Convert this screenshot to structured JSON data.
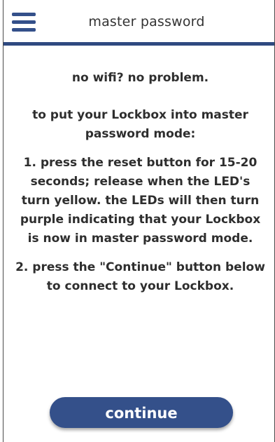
{
  "header": {
    "title": "master password",
    "menu_icon": "hamburger-menu-icon"
  },
  "colors": {
    "accent": "#34508a",
    "header_rule": "#2f4a80",
    "text": "#2e2e2e",
    "background": "#ffffff"
  },
  "instructions": {
    "intro": "no wifi? no problem.",
    "lead": "to put your Lockbox into master password mode:",
    "step1": "1. press the reset button for 15-20 seconds; release when the LED's turn yellow. the LEDs will then turn purple indicating that your Lockbox is now in master password mode.",
    "step2": "2. press the \"Continue\" button below to connect to your Lockbox."
  },
  "actions": {
    "continue_label": "continue"
  }
}
